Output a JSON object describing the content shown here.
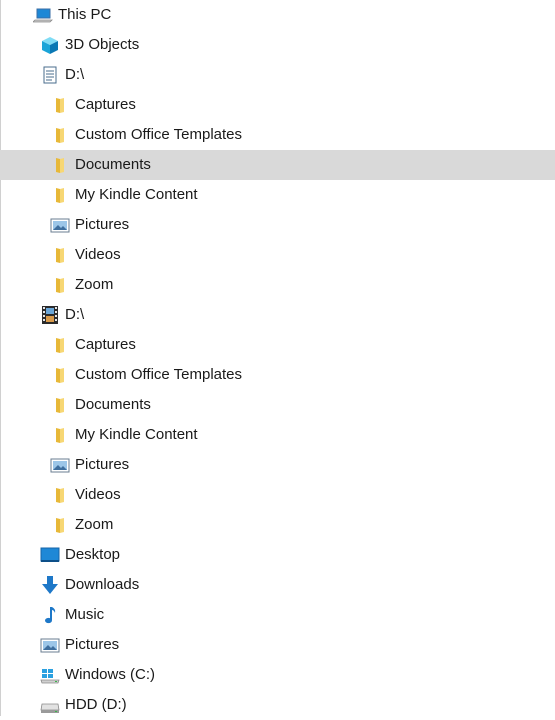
{
  "nav_tree": {
    "root": {
      "label": "This PC",
      "icon": "computer-icon"
    },
    "items": [
      {
        "label": "3D Objects",
        "icon": "3d-objects-icon",
        "level": 1
      },
      {
        "label": "D:\\",
        "icon": "library-document-icon",
        "level": 1
      },
      {
        "label": "Captures",
        "icon": "folder-icon",
        "level": 2
      },
      {
        "label": "Custom Office Templates",
        "icon": "folder-icon",
        "level": 2
      },
      {
        "label": "Documents",
        "icon": "folder-icon",
        "level": 2,
        "selected": true
      },
      {
        "label": "My Kindle Content",
        "icon": "folder-icon",
        "level": 2
      },
      {
        "label": "Pictures",
        "icon": "pictures-icon",
        "level": 2
      },
      {
        "label": "Videos",
        "icon": "folder-icon",
        "level": 2
      },
      {
        "label": "Zoom",
        "icon": "folder-icon",
        "level": 2
      },
      {
        "label": "D:\\",
        "icon": "library-video-icon",
        "level": 1
      },
      {
        "label": "Captures",
        "icon": "folder-icon",
        "level": 2
      },
      {
        "label": "Custom Office Templates",
        "icon": "folder-icon",
        "level": 2
      },
      {
        "label": "Documents",
        "icon": "folder-icon",
        "level": 2
      },
      {
        "label": "My Kindle Content",
        "icon": "folder-icon",
        "level": 2
      },
      {
        "label": "Pictures",
        "icon": "pictures-icon",
        "level": 2
      },
      {
        "label": "Videos",
        "icon": "folder-icon",
        "level": 2
      },
      {
        "label": "Zoom",
        "icon": "folder-icon",
        "level": 2
      },
      {
        "label": "Desktop",
        "icon": "desktop-icon",
        "level": 1
      },
      {
        "label": "Downloads",
        "icon": "downloads-icon",
        "level": 1
      },
      {
        "label": "Music",
        "icon": "music-icon",
        "level": 1
      },
      {
        "label": "Pictures",
        "icon": "pictures-icon",
        "level": 1
      },
      {
        "label": "Windows (C:)",
        "icon": "windows-drive-icon",
        "level": 1
      },
      {
        "label": "HDD (D:)",
        "icon": "hdd-drive-icon",
        "level": 1
      }
    ]
  },
  "colors": {
    "selected_row": "#d9d9d9",
    "folder": "#f3c94f",
    "accent_blue": "#1e88d6"
  }
}
